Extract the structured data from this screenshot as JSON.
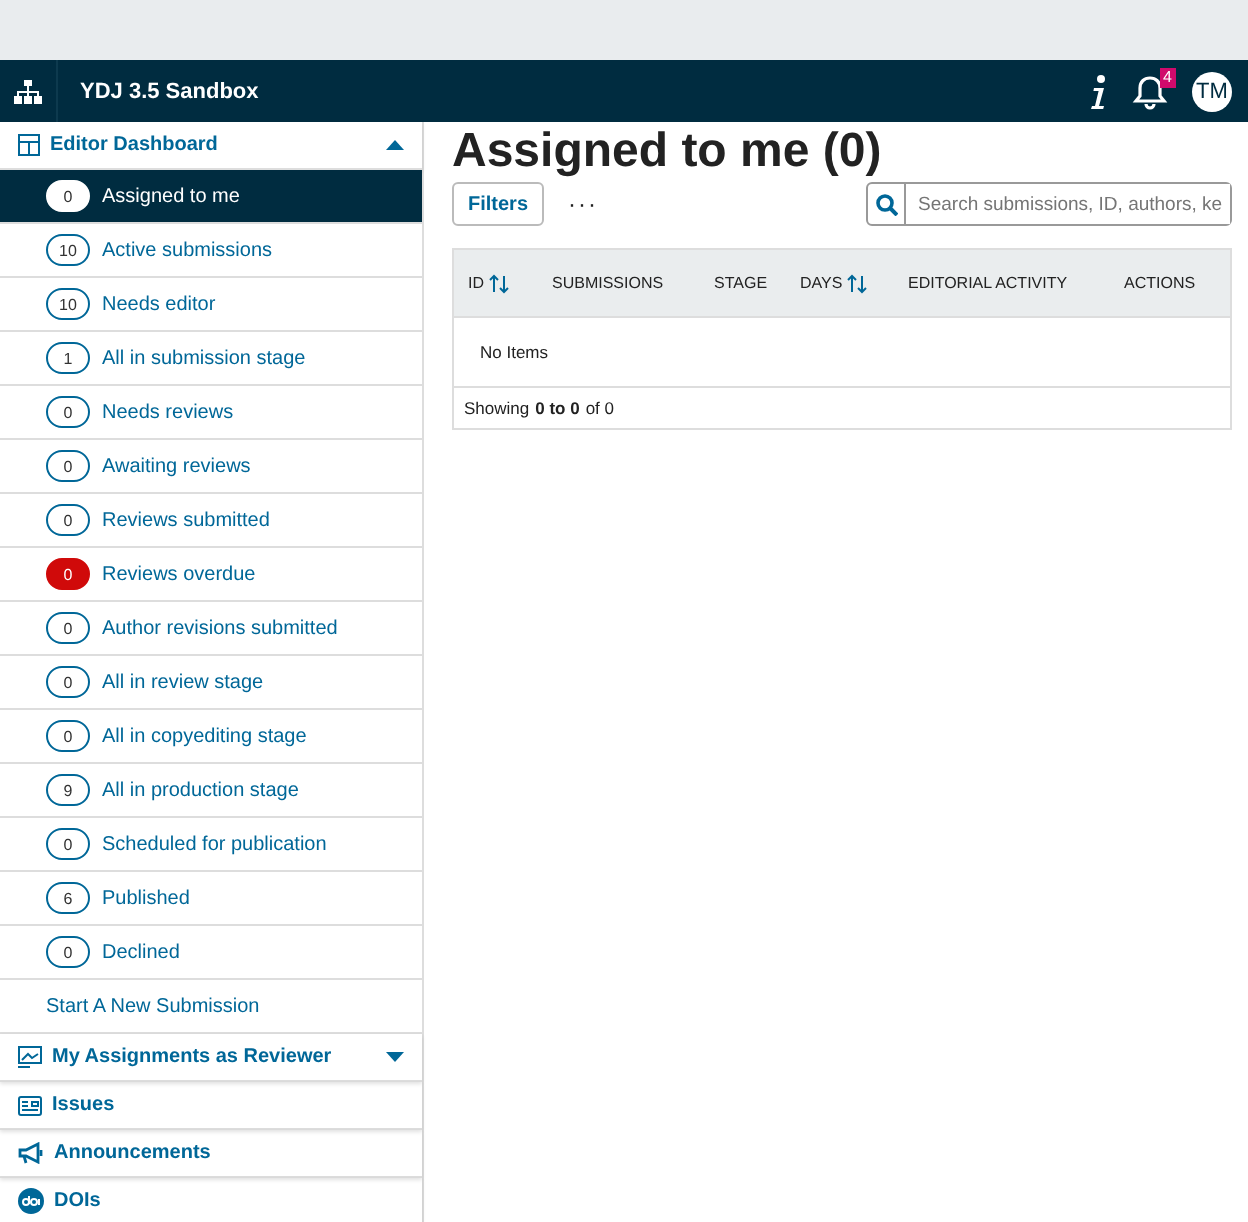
{
  "top_bar": {
    "site_title": "YDJ 3.5 Sandbox",
    "notification_count": "4",
    "avatar_initials": "TM"
  },
  "sidebar": {
    "sections": [
      {
        "label": "Editor Dashboard",
        "expanded": true,
        "items": [
          {
            "count": "0",
            "label": "Assigned to me",
            "selected": true,
            "alert": false
          },
          {
            "count": "10",
            "label": "Active submissions",
            "selected": false,
            "alert": false
          },
          {
            "count": "10",
            "label": "Needs editor",
            "selected": false,
            "alert": false
          },
          {
            "count": "1",
            "label": "All in submission stage",
            "selected": false,
            "alert": false
          },
          {
            "count": "0",
            "label": "Needs reviews",
            "selected": false,
            "alert": false
          },
          {
            "count": "0",
            "label": "Awaiting reviews",
            "selected": false,
            "alert": false
          },
          {
            "count": "0",
            "label": "Reviews submitted",
            "selected": false,
            "alert": false
          },
          {
            "count": "0",
            "label": "Reviews overdue",
            "selected": false,
            "alert": true
          },
          {
            "count": "0",
            "label": "Author revisions submitted",
            "selected": false,
            "alert": false
          },
          {
            "count": "0",
            "label": "All in review stage",
            "selected": false,
            "alert": false
          },
          {
            "count": "0",
            "label": "All in copyediting stage",
            "selected": false,
            "alert": false
          },
          {
            "count": "9",
            "label": "All in production stage",
            "selected": false,
            "alert": false
          },
          {
            "count": "0",
            "label": "Scheduled for publication",
            "selected": false,
            "alert": false
          },
          {
            "count": "6",
            "label": "Published",
            "selected": false,
            "alert": false
          },
          {
            "count": "0",
            "label": "Declined",
            "selected": false,
            "alert": false
          }
        ],
        "link": "Start A New Submission"
      },
      {
        "label": "My Assignments as Reviewer",
        "expanded": false
      },
      {
        "label": "Issues"
      },
      {
        "label": "Announcements"
      },
      {
        "label": "DOIs"
      }
    ]
  },
  "main": {
    "title": "Assigned to me (0)",
    "filters_button": "Filters",
    "more_button": "···",
    "search": {
      "placeholder": "Search submissions, ID, authors, ke"
    },
    "table": {
      "columns": [
        {
          "label": "ID",
          "sortable": true
        },
        {
          "label": "SUBMISSIONS",
          "sortable": false
        },
        {
          "label": "STAGE",
          "sortable": false
        },
        {
          "label": "DAYS",
          "sortable": true
        },
        {
          "label": "EDITORIAL ACTIVITY",
          "sortable": false
        },
        {
          "label": "ACTIONS",
          "sortable": false
        }
      ],
      "empty_message": "No Items",
      "footer": "Showing **0 to 0** of 0"
    }
  }
}
